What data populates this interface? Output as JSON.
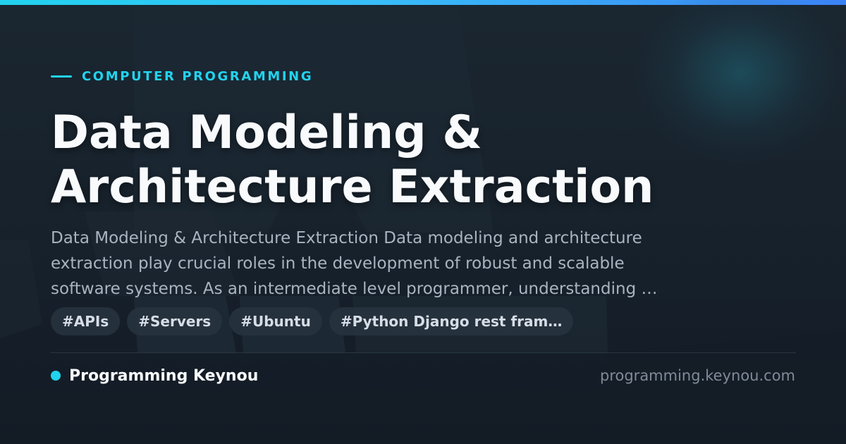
{
  "category": {
    "label": "COMPUTER PROGRAMMING"
  },
  "article": {
    "title_lines": [
      "Data Modeling &",
      "Architecture Extraction"
    ],
    "description_lines": [
      "Data Modeling & Architecture Extraction Data modeling and architecture",
      "extraction play crucial roles in the development of robust and scalable",
      "software systems. As an intermediate level programmer, understanding …"
    ]
  },
  "tags": [
    "#APIs",
    "#Servers",
    "#Ubuntu",
    "#Python Django rest fram…"
  ],
  "footer": {
    "brand_name": "Programming Keynou",
    "site_url": "programming.keynou.com"
  },
  "colors": {
    "accent": "#22d3ee",
    "background": "#17212b",
    "title_text": "#f8fafc",
    "body_text": "#aab4c0",
    "muted_text": "#808b98",
    "tag_background": "#26323e"
  }
}
